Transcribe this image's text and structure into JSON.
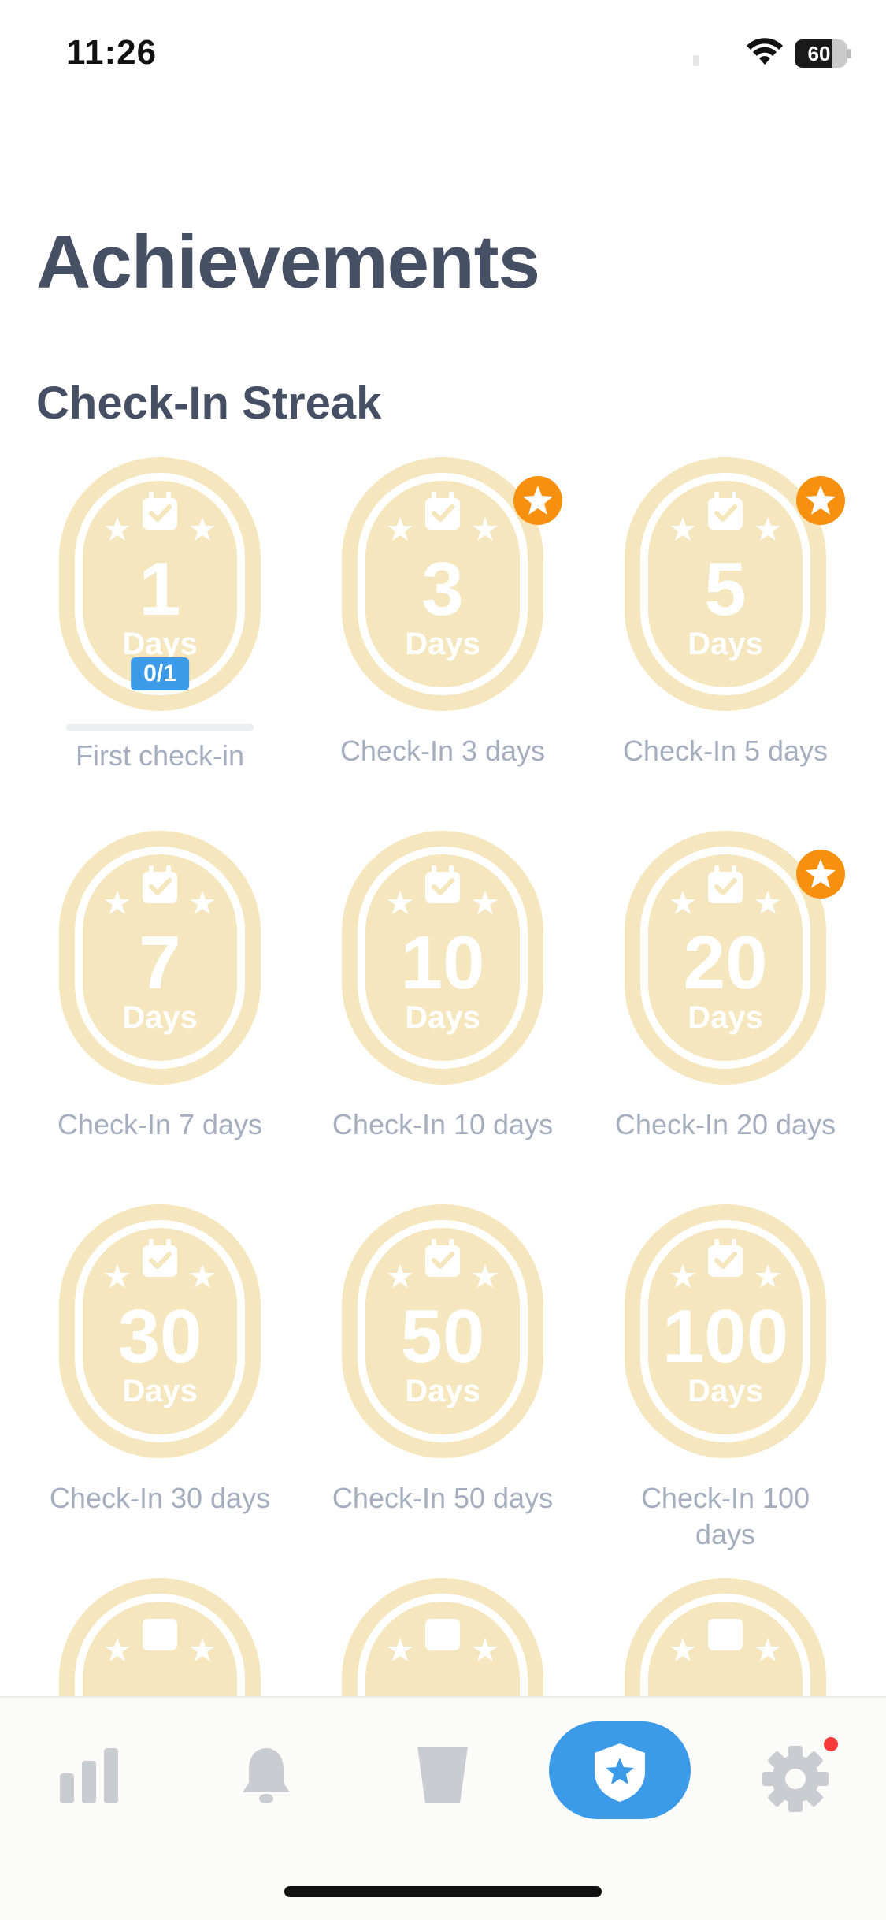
{
  "status_bar": {
    "time": "11:26",
    "battery_level": "60"
  },
  "page": {
    "title": "Achievements",
    "section_title": "Check-In Streak"
  },
  "badges": [
    {
      "number": "1",
      "unit": "Days",
      "label": "First check-in",
      "progress": "0/1",
      "starred": false
    },
    {
      "number": "3",
      "unit": "Days",
      "label": "Check-In 3 days",
      "starred": true
    },
    {
      "number": "5",
      "unit": "Days",
      "label": "Check-In 5 days",
      "starred": true
    },
    {
      "number": "7",
      "unit": "Days",
      "label": "Check-In 7 days",
      "starred": false
    },
    {
      "number": "10",
      "unit": "Days",
      "label": "Check-In 10 days",
      "starred": false
    },
    {
      "number": "20",
      "unit": "Days",
      "label": "Check-In 20 days",
      "starred": true
    },
    {
      "number": "30",
      "unit": "Days",
      "label": "Check-In 30 days",
      "starred": false
    },
    {
      "number": "50",
      "unit": "Days",
      "label": "Check-In 50 days",
      "starred": false
    },
    {
      "number": "100",
      "unit": "Days",
      "label": "Check-In 100 days",
      "starred": false
    }
  ],
  "tab_bar": {
    "items": [
      {
        "icon": "bar-chart-icon",
        "active": false
      },
      {
        "icon": "bell-icon",
        "active": false
      },
      {
        "icon": "cup-icon",
        "active": false
      },
      {
        "icon": "shield-star-icon",
        "active": true
      },
      {
        "icon": "gear-icon",
        "active": false,
        "has_notification": true
      }
    ]
  },
  "colors": {
    "title": "#465064",
    "label": "#a4aebf",
    "badge_fill": "#f5e6bd",
    "accent_blue": "#3b9be8",
    "star_orange": "#f7900e",
    "notification_red": "#f53a3a"
  }
}
